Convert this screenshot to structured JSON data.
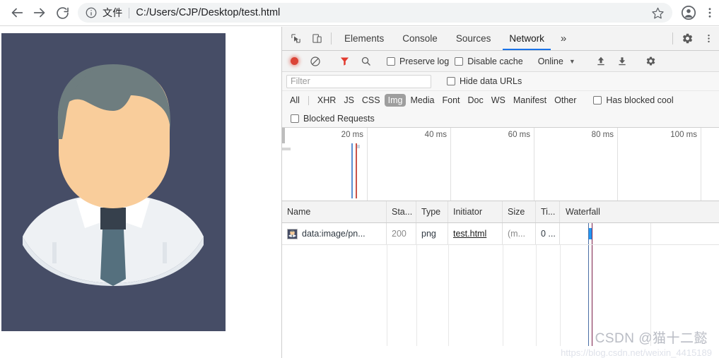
{
  "browser": {
    "back_icon": "arrow-left-icon",
    "forward_icon": "arrow-right-icon",
    "reload_icon": "reload-icon",
    "info_icon": "info-circle-icon",
    "scheme_label": "文件",
    "url": "C:/Users/CJP/Desktop/test.html",
    "star_icon": "star-icon",
    "profile_icon": "profile-avatar-icon",
    "menu_icon": "three-dot-menu-icon"
  },
  "page": {
    "image_alt": "flat-design-male-avatar",
    "colors": {
      "background": "#464d66",
      "hair": "#6e7d7f",
      "skin": "#f9cd9b",
      "shirt": "#eef1f4",
      "tie": "#55707e",
      "tie_knot": "#36404c"
    }
  },
  "devtools": {
    "inspect_icon": "inspect-cursor-icon",
    "device_icon": "device-toolbar-icon",
    "tabs": [
      {
        "label": "Elements",
        "active": false
      },
      {
        "label": "Console",
        "active": false
      },
      {
        "label": "Sources",
        "active": false
      },
      {
        "label": "Network",
        "active": true
      }
    ],
    "more_tabs_icon": "»",
    "settings_icon": "gear-icon",
    "dots_icon": "three-dot-menu-icon",
    "accent_color": "#1a73e8",
    "toolbar": {
      "record_icon": "record-dot-icon",
      "clear_icon": "clear-circle-slash-icon",
      "filter_icon": "funnel-filter-icon",
      "search_icon": "search-magnifier-icon",
      "preserve_log_label": "Preserve log",
      "preserve_log_checked": false,
      "disable_cache_label": "Disable cache",
      "disable_cache_checked": false,
      "throttling_value": "Online",
      "throttling_caret": "▼",
      "import_icon": "upload-arrow-icon",
      "export_icon": "download-arrow-icon"
    },
    "filter_row": {
      "filter_placeholder": "Filter",
      "filter_value": "",
      "hide_data_urls_label": "Hide data URLs",
      "hide_data_urls_checked": false
    },
    "type_filters": [
      {
        "label": "All",
        "active": false
      },
      {
        "label": "XHR",
        "active": false
      },
      {
        "label": "JS",
        "active": false
      },
      {
        "label": "CSS",
        "active": false
      },
      {
        "label": "Img",
        "active": true
      },
      {
        "label": "Media",
        "active": false
      },
      {
        "label": "Font",
        "active": false
      },
      {
        "label": "Doc",
        "active": false
      },
      {
        "label": "WS",
        "active": false
      },
      {
        "label": "Manifest",
        "active": false
      },
      {
        "label": "Other",
        "active": false
      }
    ],
    "has_blocked_cookies_label": "Has blocked cool",
    "has_blocked_cookies_checked": false,
    "blocked_requests_label": "Blocked Requests",
    "blocked_requests_checked": false,
    "overview": {
      "ticks": [
        "20 ms",
        "40 ms",
        "60 ms",
        "80 ms",
        "100 ms"
      ],
      "max_ms": 110,
      "dom_content_loaded_ms": 17,
      "load_event_ms": 18.5,
      "dom_content_loaded_color": "#5b8fd4",
      "load_event_color": "#c9544b"
    },
    "table": {
      "columns": [
        "Name",
        "Sta...",
        "Type",
        "Initiator",
        "Size",
        "Ti...",
        "Waterfall"
      ],
      "rows": [
        {
          "thumb_icon": "image-thumbnail-icon",
          "name": "data:image/pn...",
          "status": "200",
          "type": "png",
          "initiator": "test.html",
          "size": "(m...",
          "time": "0 ..."
        }
      ]
    }
  },
  "watermark": {
    "text": "CSDN @猫十二懿",
    "url": "https://blog.csdn.net/weixin_4415189"
  }
}
